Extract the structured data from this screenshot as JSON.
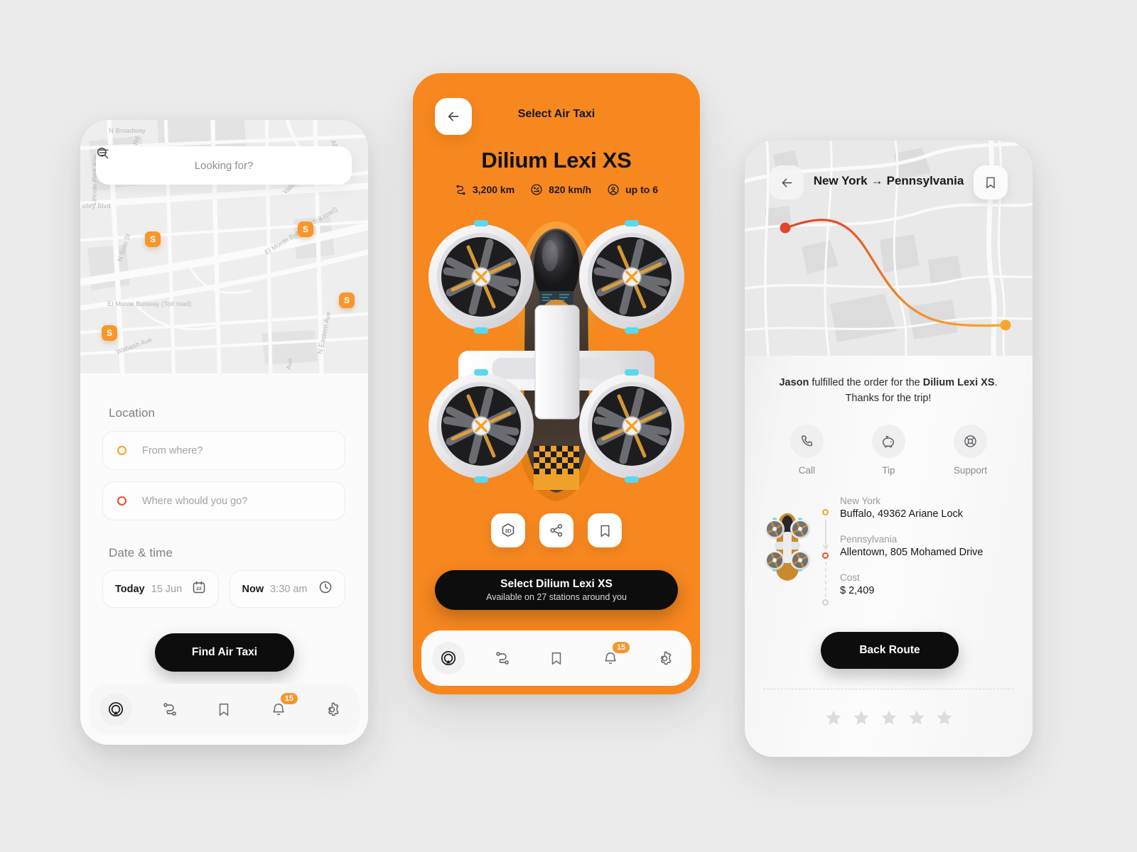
{
  "app": {
    "accent_orange": "#F7871F",
    "accent_amber": "#F9962B",
    "accent_red": "#F04E23",
    "black": "#0D0D0D",
    "page_bg": "#ECECEC"
  },
  "phone1": {
    "search": {
      "placeholder": "Looking for?",
      "search_icon": "search-icon",
      "filter_icon": "filter-icon"
    },
    "map": {
      "station_label": "S",
      "labels": [
        "N Broadway",
        "Lincoln Park Ave",
        "Alhambra",
        "Valley",
        "alley Blvd",
        "N Soto St",
        "El Monte Busway (Toll road)",
        "El Monte Busway (Toll road)",
        "N Eastern Ave",
        "Wabash Ave",
        "Ave",
        "Rd"
      ]
    },
    "location": {
      "section_label": "Location",
      "from_placeholder": "From where?",
      "to_placeholder": "Where whould you go?"
    },
    "datetime": {
      "section_label": "Date & time",
      "date_key": "Today",
      "date_value": "15 Jun",
      "calendar_day": "22",
      "time_key": "Now",
      "time_value": "3:30 am"
    },
    "find_button": "Find Air Taxi",
    "nav": [
      {
        "name": "home",
        "icon": "radar-home-icon",
        "active": true,
        "badge": ""
      },
      {
        "name": "routes",
        "icon": "route-icon",
        "active": false,
        "badge": ""
      },
      {
        "name": "saved",
        "icon": "bookmark-icon",
        "active": false,
        "badge": ""
      },
      {
        "name": "notifications",
        "icon": "bell-icon",
        "active": false,
        "badge": "15"
      },
      {
        "name": "settings",
        "icon": "gear-icon",
        "active": false,
        "badge": ""
      }
    ]
  },
  "phone2": {
    "title": "Select Air Taxi",
    "back_icon": "arrow-left-icon",
    "model": "Dilium Lexi XS",
    "specs": [
      {
        "icon": "route-icon",
        "value": "3,200 km"
      },
      {
        "icon": "speedometer-icon",
        "value": "820 km/h"
      },
      {
        "icon": "seats-icon",
        "value": "up to 6"
      }
    ],
    "actions": [
      {
        "name": "view-3d",
        "icon": "3d-icon",
        "label": "3D"
      },
      {
        "name": "share",
        "icon": "share-icon",
        "label": ""
      },
      {
        "name": "bookmark",
        "icon": "bookmark-icon",
        "label": ""
      }
    ],
    "cta_primary": "Select Dilium Lexi XS",
    "cta_secondary": "Available on 27 stations around you",
    "nav": [
      {
        "name": "home",
        "icon": "radar-home-icon",
        "active": true,
        "badge": ""
      },
      {
        "name": "routes",
        "icon": "route-icon",
        "active": false,
        "badge": ""
      },
      {
        "name": "saved",
        "icon": "bookmark-icon",
        "active": false,
        "badge": ""
      },
      {
        "name": "notifications",
        "icon": "bell-icon",
        "active": false,
        "badge": "15"
      },
      {
        "name": "settings",
        "icon": "gear-icon",
        "active": false,
        "badge": ""
      }
    ]
  },
  "phone3": {
    "back_icon": "arrow-left-icon",
    "bookmark_icon": "bookmark-icon",
    "route_from": "New York",
    "route_arrow": "→",
    "route_to": "Pennsylvania",
    "message_driver": "Jason",
    "message_mid": " fulfilled the order for the ",
    "message_model": "Dilium Lexi XS",
    "message_end": ". Thanks for the trip!",
    "quick_actions": [
      {
        "name": "call",
        "icon": "phone-icon",
        "label": "Call"
      },
      {
        "name": "tip",
        "icon": "piggy-bank-icon",
        "label": "Tip"
      },
      {
        "name": "support",
        "icon": "lifebuoy-icon",
        "label": "Support"
      }
    ],
    "trip": [
      {
        "caption": "New York",
        "value": "Buffalo, 49362 Ariane Lock"
      },
      {
        "caption": "Pennsylvania",
        "value": "Allentown, 805 Mohamed Drive"
      },
      {
        "caption": "Cost",
        "value": "$ 2,409"
      }
    ],
    "back_route_button": "Back Route",
    "rating_stars": 5,
    "rating_filled": 0
  }
}
